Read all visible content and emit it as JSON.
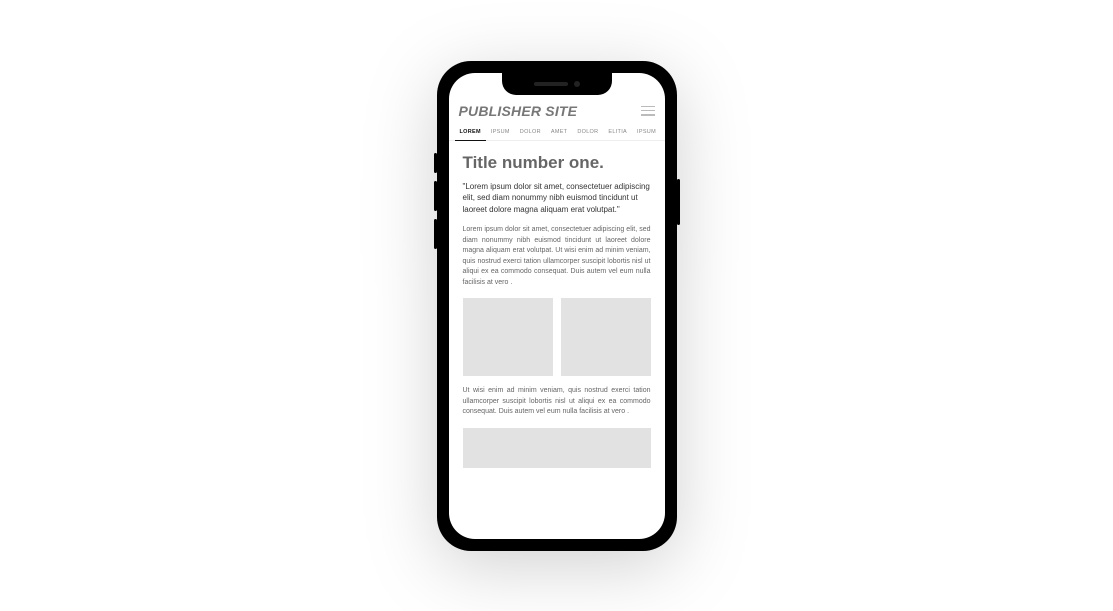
{
  "header": {
    "site_title": "PUBLISHER SITE"
  },
  "tabs": [
    {
      "label": "LOREM",
      "active": true
    },
    {
      "label": "IPSUM",
      "active": false
    },
    {
      "label": "DOLOR",
      "active": false
    },
    {
      "label": "AMET",
      "active": false
    },
    {
      "label": "DOLOR",
      "active": false
    },
    {
      "label": "ELITIA",
      "active": false
    },
    {
      "label": "IPSUM",
      "active": false
    }
  ],
  "article": {
    "title": "Title number one.",
    "quote": "\"Lorem ipsum dolor sit amet, consectetuer adipiscing elit, sed diam nonummy nibh euismod tincidunt ut laoreet dolore magna aliquam erat volutpat.\"",
    "body1": "Lorem ipsum dolor sit amet, consectetuer adipiscing elit, sed diam nonummy nibh euismod tincidunt ut laoreet dolore magna aliquam erat volutpat. Ut wisi enim ad minim veniam, quis nostrud exerci tation ullamcorper suscipit lobortis nisl ut aliqui ex ea commodo consequat. Duis autem vel eum nulla facilisis at vero .",
    "body2": "Ut wisi enim ad minim veniam, quis nostrud exerci tation ullamcorper suscipit lobortis nisl ut aliqui ex ea commodo consequat. Duis autem vel eum nulla facilisis at vero ."
  }
}
